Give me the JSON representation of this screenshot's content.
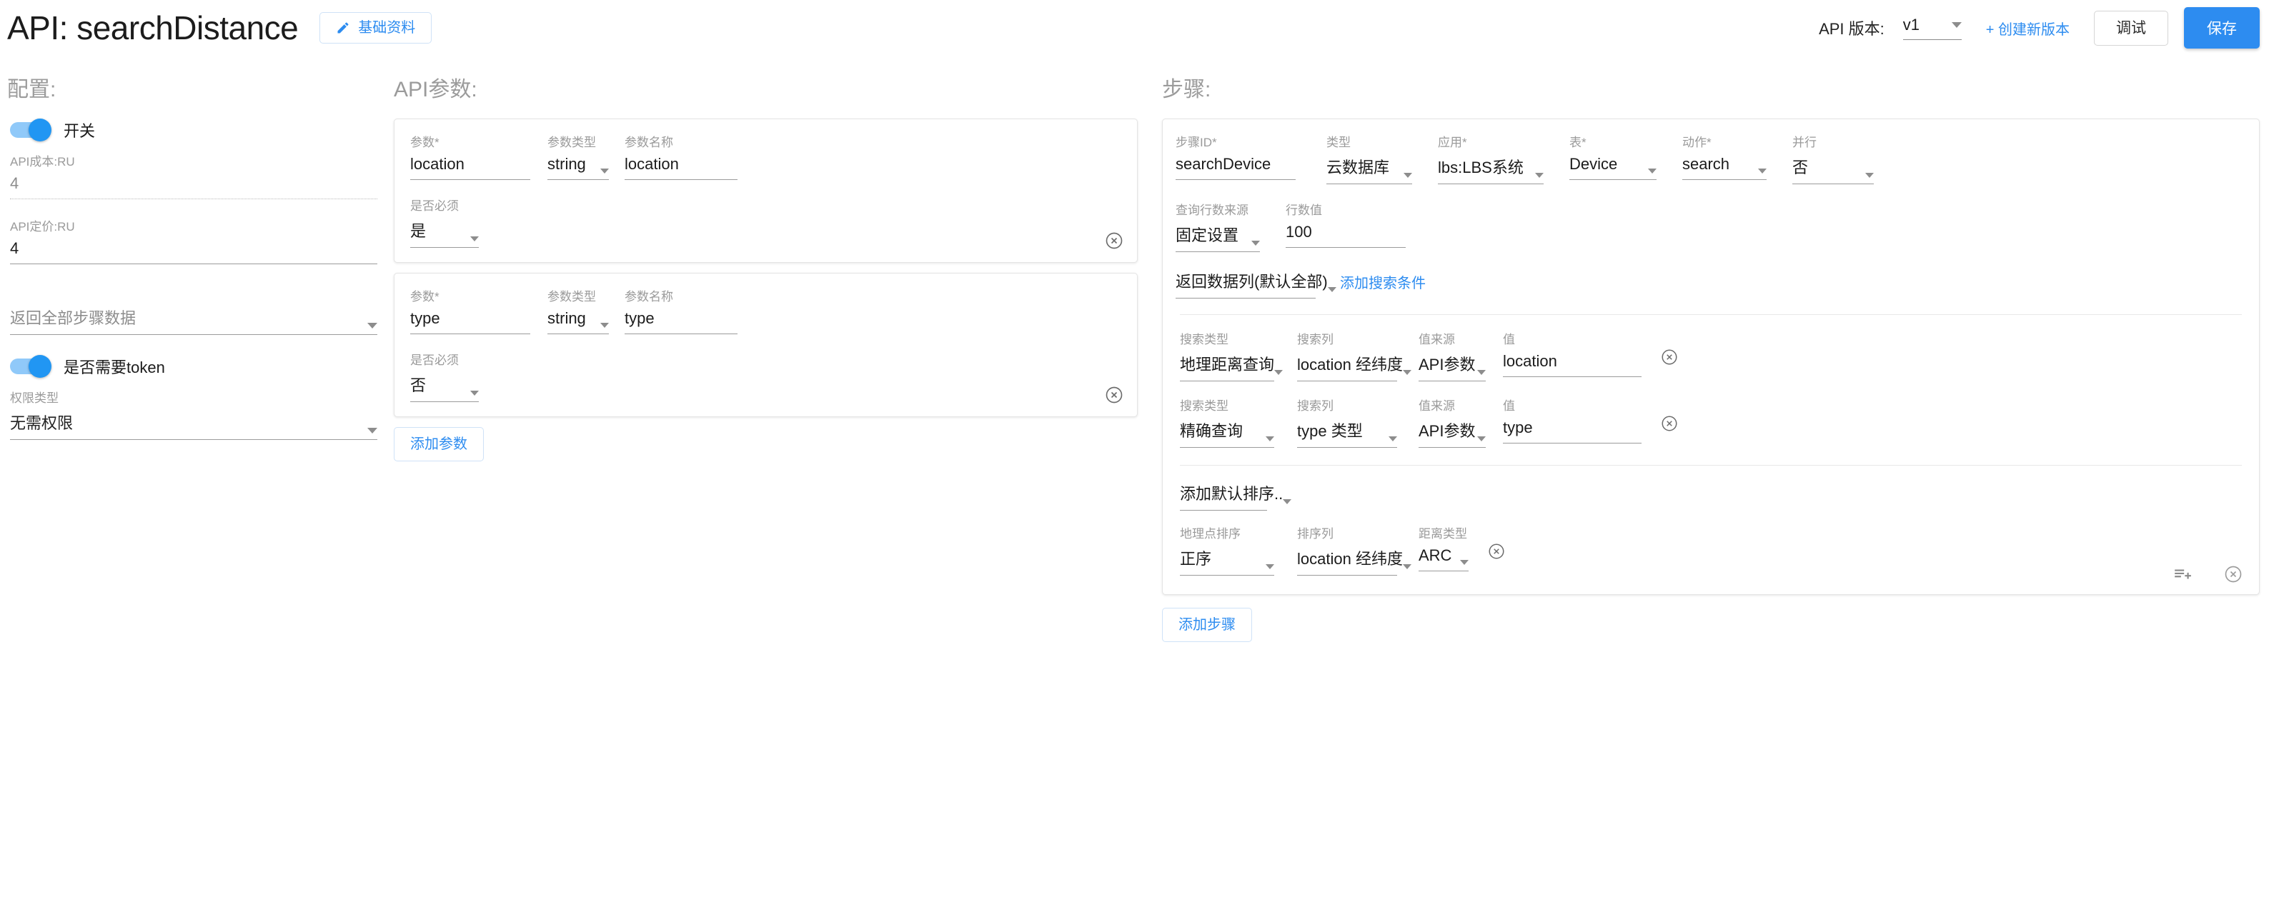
{
  "header": {
    "title": "API: searchDistance",
    "basic_info_button": "基础资料",
    "version_label": "API 版本:",
    "version_value": "v1",
    "create_version_link": "+ 创建新版本",
    "debug_button": "调试",
    "save_button": "保存",
    "accent_color": "#2d8cf0"
  },
  "config": {
    "section_title": "配置:",
    "switch_label": "开关",
    "cost_label": "API成本:RU",
    "cost_value": "4",
    "price_label": "API定价:RU",
    "price_value": "4",
    "return_all_steps": "返回全部步骤数据",
    "token_label": "是否需要token",
    "perm_label": "权限类型",
    "perm_value": "无需权限"
  },
  "params": {
    "section_title": "API参数:",
    "labels": {
      "param": "参数",
      "param_required_mark": "*",
      "param_type": "参数类型",
      "param_name": "参数名称",
      "required": "是否必须"
    },
    "add_button": "添加参数",
    "items": [
      {
        "param": "location",
        "type": "string",
        "name": "location",
        "required": "是"
      },
      {
        "param": "type",
        "type": "string",
        "name": "type",
        "required": "否"
      }
    ]
  },
  "steps": {
    "section_title": "步骤:",
    "add_button": "添加步骤",
    "labels": {
      "step_id": "步骤ID",
      "type": "类型",
      "app": "应用",
      "table": "表",
      "action": "动作",
      "parallel": "并行",
      "row_count_source": "查询行数来源",
      "row_count_value": "行数值",
      "search_type": "搜索类型",
      "search_column": "搜索列",
      "value_source": "值来源",
      "value": "值",
      "geo_sort": "地理点排序",
      "sort_column": "排序列",
      "distance_type": "距离类型",
      "required_mark": "*"
    },
    "item": {
      "step_id": "searchDevice",
      "type": "云数据库",
      "app": "lbs:LBS系统",
      "table": "Device",
      "action": "search",
      "parallel": "否",
      "row_count_source": "固定设置",
      "row_count_value": "100",
      "return_columns": "返回数据列(默认全部)",
      "add_condition_link": "添加搜索条件",
      "conditions": [
        {
          "search_type": "地理距离查询",
          "search_column": "location 经纬度",
          "value_source": "API参数",
          "value": "location"
        },
        {
          "search_type": "精确查询",
          "search_column": "type 类型",
          "value_source": "API参数",
          "value": "type"
        }
      ],
      "add_default_sort": "添加默认排序..",
      "sorts": [
        {
          "geo_sort": "正序",
          "sort_column": "location 经纬度",
          "distance_type": "ARC"
        }
      ]
    }
  }
}
